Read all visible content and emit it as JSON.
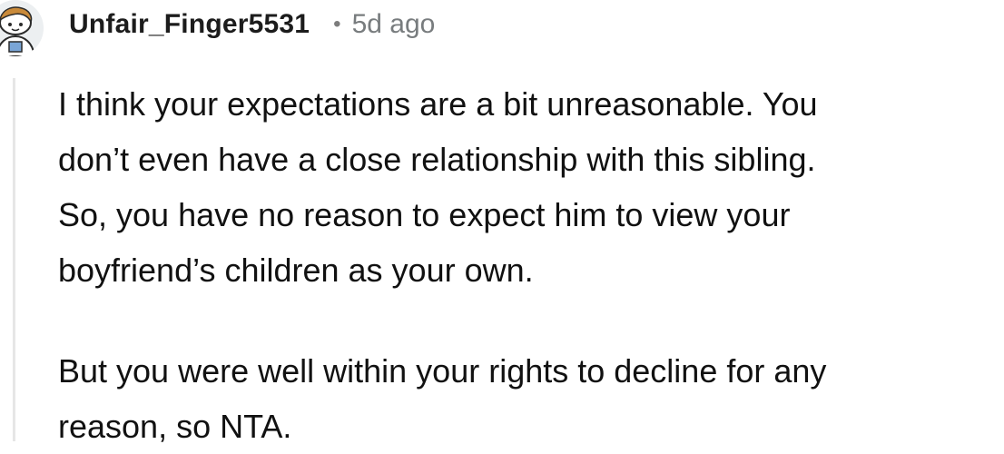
{
  "comment": {
    "author": "Unfair_Finger5531",
    "separator": "•",
    "time_ago": "5d ago",
    "paragraphs": [
      "I think your expectations are a bit unreasonable. You\ndon’t even have a close relationship with this sibling.\nSo, you have no reason to expect him to view your\nboyfriend’s children as your own.",
      "But you were well within your rights to decline for any\nreason, so NTA."
    ]
  },
  "colors": {
    "username": "#1c1c1c",
    "meta": "#787c7e",
    "body_text": "#111111",
    "thread_line": "#e6e6e6",
    "background": "#ffffff"
  },
  "icons": {
    "avatar": "snoo-avatar-icon"
  }
}
